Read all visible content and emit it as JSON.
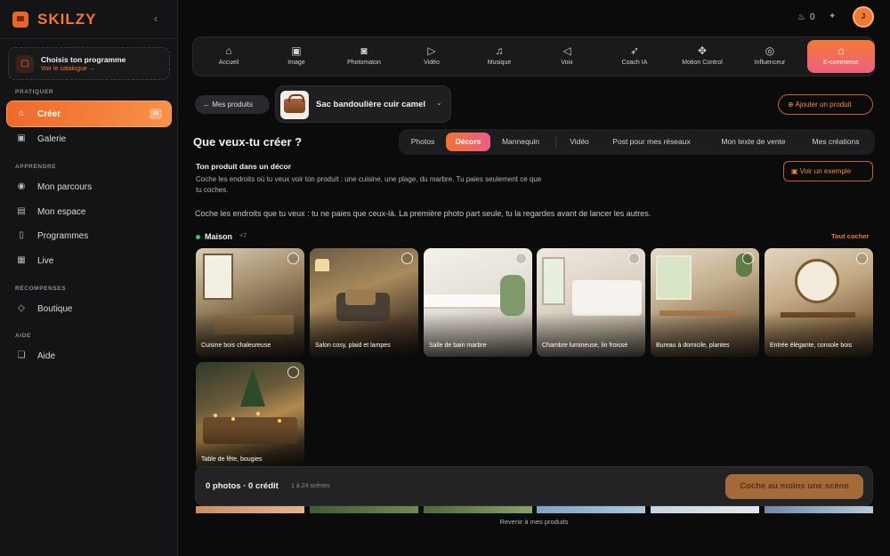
{
  "brand": {
    "name": "SKILZY",
    "collapse_icon": "‹"
  },
  "program_card": {
    "title": "Choisis ton programme",
    "link": "Voir le catalogue →"
  },
  "sidebar": {
    "sections": [
      "PRATIQUER",
      "APPRENDRE",
      "RÉCOMPENSES",
      "AIDE"
    ],
    "items": [
      {
        "label": "Créer",
        "icon": "store-icon",
        "badge": "IA",
        "active": true
      },
      {
        "label": "Galerie",
        "icon": "image-icon"
      },
      {
        "label": "Mon parcours",
        "icon": "pin-icon"
      },
      {
        "label": "Mon espace",
        "icon": "document-icon"
      },
      {
        "label": "Programmes",
        "icon": "book-icon"
      },
      {
        "label": "Live",
        "icon": "calendar-icon"
      },
      {
        "label": "Boutique",
        "icon": "diamond-icon"
      },
      {
        "label": "Aide",
        "icon": "book-open-icon"
      }
    ]
  },
  "topbar": {
    "credits": "0",
    "avatar_initial": "J"
  },
  "tools": [
    {
      "label": "Accueil",
      "icon": "home-icon"
    },
    {
      "label": "Image",
      "icon": "image-icon"
    },
    {
      "label": "Photomaton",
      "icon": "camera-icon"
    },
    {
      "label": "Vidéo",
      "icon": "play-icon"
    },
    {
      "label": "Musique",
      "icon": "music-icon"
    },
    {
      "label": "Voix",
      "icon": "megaphone-icon"
    },
    {
      "label": "Coach IA",
      "icon": "rocket-icon"
    },
    {
      "label": "Motion Control",
      "icon": "move-icon"
    },
    {
      "label": "Influenceur",
      "icon": "user-circle-icon"
    },
    {
      "label": "E-commerce",
      "icon": "store-icon",
      "active": true
    }
  ],
  "product": {
    "back_label": "← Mes produits",
    "selected_name": "Sac bandoulière cuir camel",
    "add_label": "⊕ Ajouter un produit"
  },
  "question": "Que veux-tu créer ?",
  "tabs": [
    "Photos",
    "Décors",
    "Mannequin",
    "Vidéo",
    "Post pour mes réseaux",
    "Mon texte de vente",
    "Mes créations"
  ],
  "active_tab": "Décors",
  "section": {
    "title": "Ton produit dans un décor",
    "description": "Coche les endroits où tu veux voir ton produit : une cuisine, une plage, du marbre. Tu paies seulement ce que tu coches.",
    "example_label": "Voir un exemple",
    "instruction": "Coche les endroits que tu veux : tu ne paies que ceux-là. La première photo part seule, tu la regardes avant de lancer les autres."
  },
  "category": {
    "name": "Maison",
    "count": "+7",
    "select_all": "Tout cocher"
  },
  "scenes": [
    "Cuisine bois chaleureuse",
    "Salon cosy, plaid et lampes",
    "Salle de bain marbre",
    "Chambre lumineuse, lin froissé",
    "Bureau à domicile, plantes",
    "Entrée élégante, console bois",
    "Table de fête, bougies"
  ],
  "bottom_bar": {
    "count_label": "0 photos · 0 crédit",
    "sub_label": "1 à 24 scènes",
    "cta_label": "Coche au moins une scène"
  },
  "footer_link": "Revenir à mes produits"
}
